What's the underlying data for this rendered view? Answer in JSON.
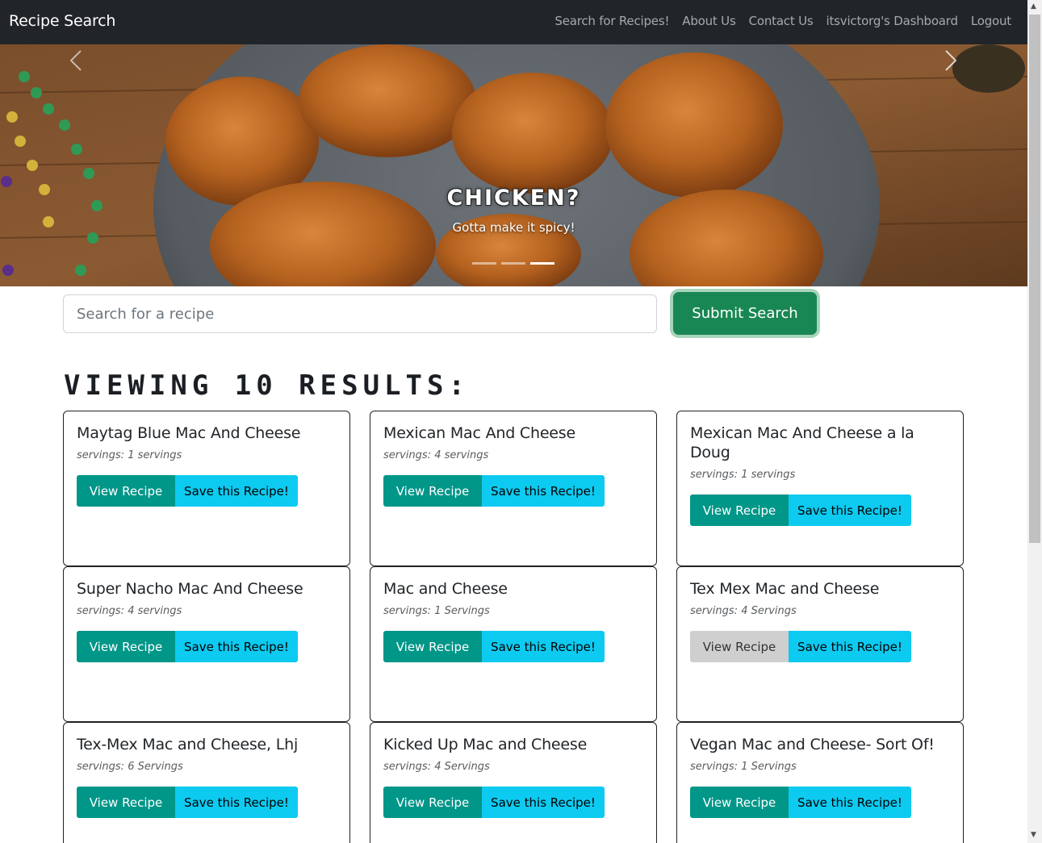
{
  "nav": {
    "brand": "Recipe Search",
    "links": [
      "Search for Recipes!",
      "About Us",
      "Contact Us",
      "itsvictorg's Dashboard",
      "Logout"
    ]
  },
  "carousel": {
    "title": "CHICKEN?",
    "subtitle": "Gotta make it spicy!",
    "slide_count": 3,
    "active_slide": 3
  },
  "search": {
    "placeholder": "Search for a recipe",
    "value": "",
    "submit_label": "Submit Search"
  },
  "results": {
    "heading": "VIEWING 10 RESULTS:",
    "view_label": "View Recipe",
    "save_label": "Save this Recipe!",
    "cards": [
      {
        "title": "Maytag Blue Mac And Cheese",
        "servings": "servings: 1 servings"
      },
      {
        "title": "Mexican Mac And Cheese",
        "servings": "servings: 4 servings"
      },
      {
        "title": "Mexican Mac And Cheese a la Doug",
        "servings": "servings: 1 servings"
      },
      {
        "title": "Super Nacho Mac And Cheese",
        "servings": "servings: 4 servings"
      },
      {
        "title": "Mac and Cheese",
        "servings": "servings: 1 Servings"
      },
      {
        "title": "Tex Mex Mac and Cheese",
        "servings": "servings: 4 Servings"
      },
      {
        "title": "Tex-Mex Mac and Cheese, Lhj",
        "servings": "servings: 6 Servings"
      },
      {
        "title": "Kicked Up Mac and Cheese",
        "servings": "servings: 4 Servings"
      },
      {
        "title": "Vegan Mac and Cheese- Sort Of!",
        "servings": "servings: 1 Servings"
      }
    ]
  },
  "colors": {
    "navbar": "#212529",
    "view_button": "#009688",
    "save_button": "#0dcaf0",
    "submit_button": "#198754"
  }
}
